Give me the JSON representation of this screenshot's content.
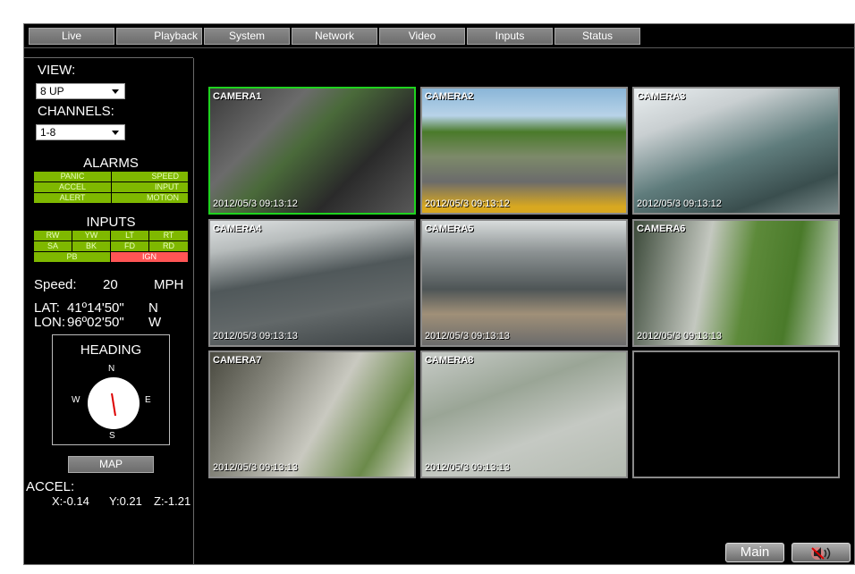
{
  "nav": {
    "tabs": [
      "Live",
      "Playback",
      "System",
      "Network",
      "Video",
      "Inputs",
      "Status"
    ]
  },
  "controls": {
    "view_label": "VIEW:",
    "view_value": "8 UP",
    "channels_label": "CHANNELS:",
    "channels_value": "1-8"
  },
  "alarms": {
    "title": "ALARMS",
    "items": [
      "PANIC",
      "SPEED",
      "ACCEL",
      "INPUT",
      "ALERT",
      "MOTION"
    ]
  },
  "inputs": {
    "title": "INPUTS",
    "row1": [
      "RW",
      "YW",
      "LT",
      "RT"
    ],
    "row2": [
      "SA",
      "BK",
      "FD",
      "RD"
    ],
    "row3": [
      "PB",
      "IGN"
    ]
  },
  "telemetry": {
    "speed_label": "Speed:",
    "speed_value": "20",
    "speed_unit": "MPH",
    "lat_label": "LAT:",
    "lat_value": "41º14'50\"",
    "lat_dir": "N",
    "lon_label": "LON:",
    "lon_value": "96º02'50\"",
    "lon_dir": "W"
  },
  "heading": {
    "title": "HEADING",
    "n": "N",
    "e": "E",
    "s": "S",
    "w": "W"
  },
  "map_button": "MAP",
  "accel": {
    "label": "ACCEL:",
    "x": "X:-0.14",
    "y": "Y:0.21",
    "z": "Z:-1.21"
  },
  "cameras": [
    {
      "name": "CAMERA1",
      "timestamp": "2012/05/3  09:13:12"
    },
    {
      "name": "CAMERA2",
      "timestamp": "2012/05/3  09:13:12"
    },
    {
      "name": "CAMERA3",
      "timestamp": "2012/05/3  09:13:12"
    },
    {
      "name": "CAMERA4",
      "timestamp": "2012/05/3  09:13:13"
    },
    {
      "name": "CAMERA5",
      "timestamp": "2012/05/3  09:13:13"
    },
    {
      "name": "CAMERA6",
      "timestamp": "2012/05/3  09:13:13"
    },
    {
      "name": "CAMERA7",
      "timestamp": "2012/05/3  09:13:13"
    },
    {
      "name": "CAMERA8",
      "timestamp": "2012/05/3  09:13:13"
    }
  ],
  "bottom": {
    "main_button": "Main"
  }
}
